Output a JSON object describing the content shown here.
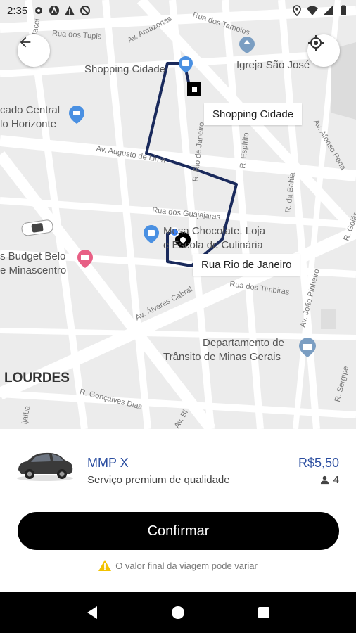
{
  "status_bar": {
    "time": "2:35"
  },
  "map": {
    "labels": {
      "shopping_cidade_poi": "Shopping Cidade",
      "igreja": "Igreja São José",
      "mercado_line1": "cado Central",
      "mercado_line2": "lo Horizonte",
      "budget_line1": "s Budget Belo",
      "budget_line2": "e Minascentro",
      "chocolate_line1": "Mesa Chocolate. Loja",
      "chocolate_line2": "e Escola de Culinária",
      "detran_line1": "Departamento de",
      "detran_line2": "Trânsito de Minas Gerais",
      "lourdes": "LOURDES",
      "rua_tupis": "Rua dos Tupis",
      "av_amazonas": "Av. Amazonas",
      "rua_tamoios": "Rua dos Tamoios",
      "av_augusto": "Av. Augusto de Lima",
      "rua_guajajaras": "Rua dos Guajajaras",
      "r_janeiro": "R. Rio de Janeiro",
      "r_espirito": "R. Espírito",
      "r_bahia": "R. da Bahia",
      "av_afonso": "Av. Afonso Pena",
      "r_goias": "R. Goiás",
      "av_alvares": "Av. Álvares Cabral",
      "rua_timbiras": "Rua dos Timbiras",
      "av_joao": "Av. João Pinheiro",
      "r_sergipe": "R. Sergipe",
      "r_goncalves": "R. Gonçalves Dias",
      "av_bias": "Av. Bi",
      "r_macei": "R. Macei",
      "jaiba": "ijaíba"
    },
    "destination_callout": "Shopping Cidade",
    "origin_callout": "Rua Rio de Janeiro"
  },
  "ride": {
    "name": "MMP X",
    "description": "Serviço premium de qualidade",
    "price": "R$5,50",
    "seats": "4"
  },
  "confirm_label": "Confirmar",
  "warning_text": "O valor final da viagem pode variar",
  "colors": {
    "route": "#1a2a5c",
    "accent_blue": "#2a4da0",
    "origin_dot": "#3b82f6",
    "poi_blue": "#4a90e2",
    "poi_pink": "#e85f85",
    "warning_yellow": "#f2c200"
  }
}
